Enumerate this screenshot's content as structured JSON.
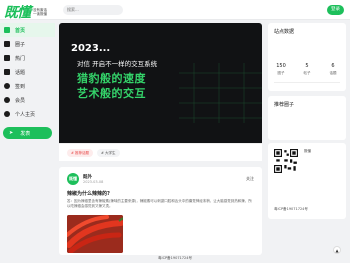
{
  "header": {
    "logo_text": "既懂",
    "logo_tagline_1": "没有废话",
    "logo_tagline_2": "一读既懂",
    "search_placeholder": "搜索...",
    "login_label": "登录"
  },
  "sidebar": {
    "items": [
      {
        "label": "首页",
        "icon": "home-icon"
      },
      {
        "label": "圈子",
        "icon": "circle-group-icon"
      },
      {
        "label": "热门",
        "icon": "fire-icon"
      },
      {
        "label": "话题",
        "icon": "topic-icon"
      },
      {
        "label": "签到",
        "icon": "checkin-icon"
      },
      {
        "label": "会员",
        "icon": "member-icon"
      },
      {
        "label": "个人主页",
        "icon": "user-icon"
      }
    ],
    "post_button": "发表"
  },
  "banner": {
    "year": "2023...",
    "subtitle": "对信 开启不一样的交互系统",
    "line1": "猎豹般的速度",
    "line2": "艺术般的交互"
  },
  "tags": {
    "hot": "# 推荐话题",
    "plain": "# 大学生"
  },
  "post": {
    "avatar_text": "既懂",
    "author": "既外",
    "time": "2023-03-08",
    "follow_label": "关注",
    "title": "辣椒为什么辣辣的?",
    "body": "答：因为辣椒里含有辣椒素(辣味的主要来源)，辣椒素可以刺激口腔和舌头中的痛觉神经末梢，让大脑感觉到热和辣，所以吃辣椒会感觉到又辣又烫。"
  },
  "right_panel": {
    "panel1_title": "站点数据",
    "stats": [
      {
        "num": "150",
        "label": "圈子"
      },
      {
        "num": "5",
        "label": "帖子"
      },
      {
        "num": "6",
        "label": "话题"
      }
    ],
    "panel2_title": "推荐圈子",
    "qr_caption": "既懂",
    "icp": "粤ICP备19071724号"
  },
  "footer": {
    "icp": "粤ICP备19071724号"
  },
  "colors": {
    "brand": "#1dbf5b",
    "banner_bg": "#111214",
    "banner_accent": "#34d36a"
  }
}
